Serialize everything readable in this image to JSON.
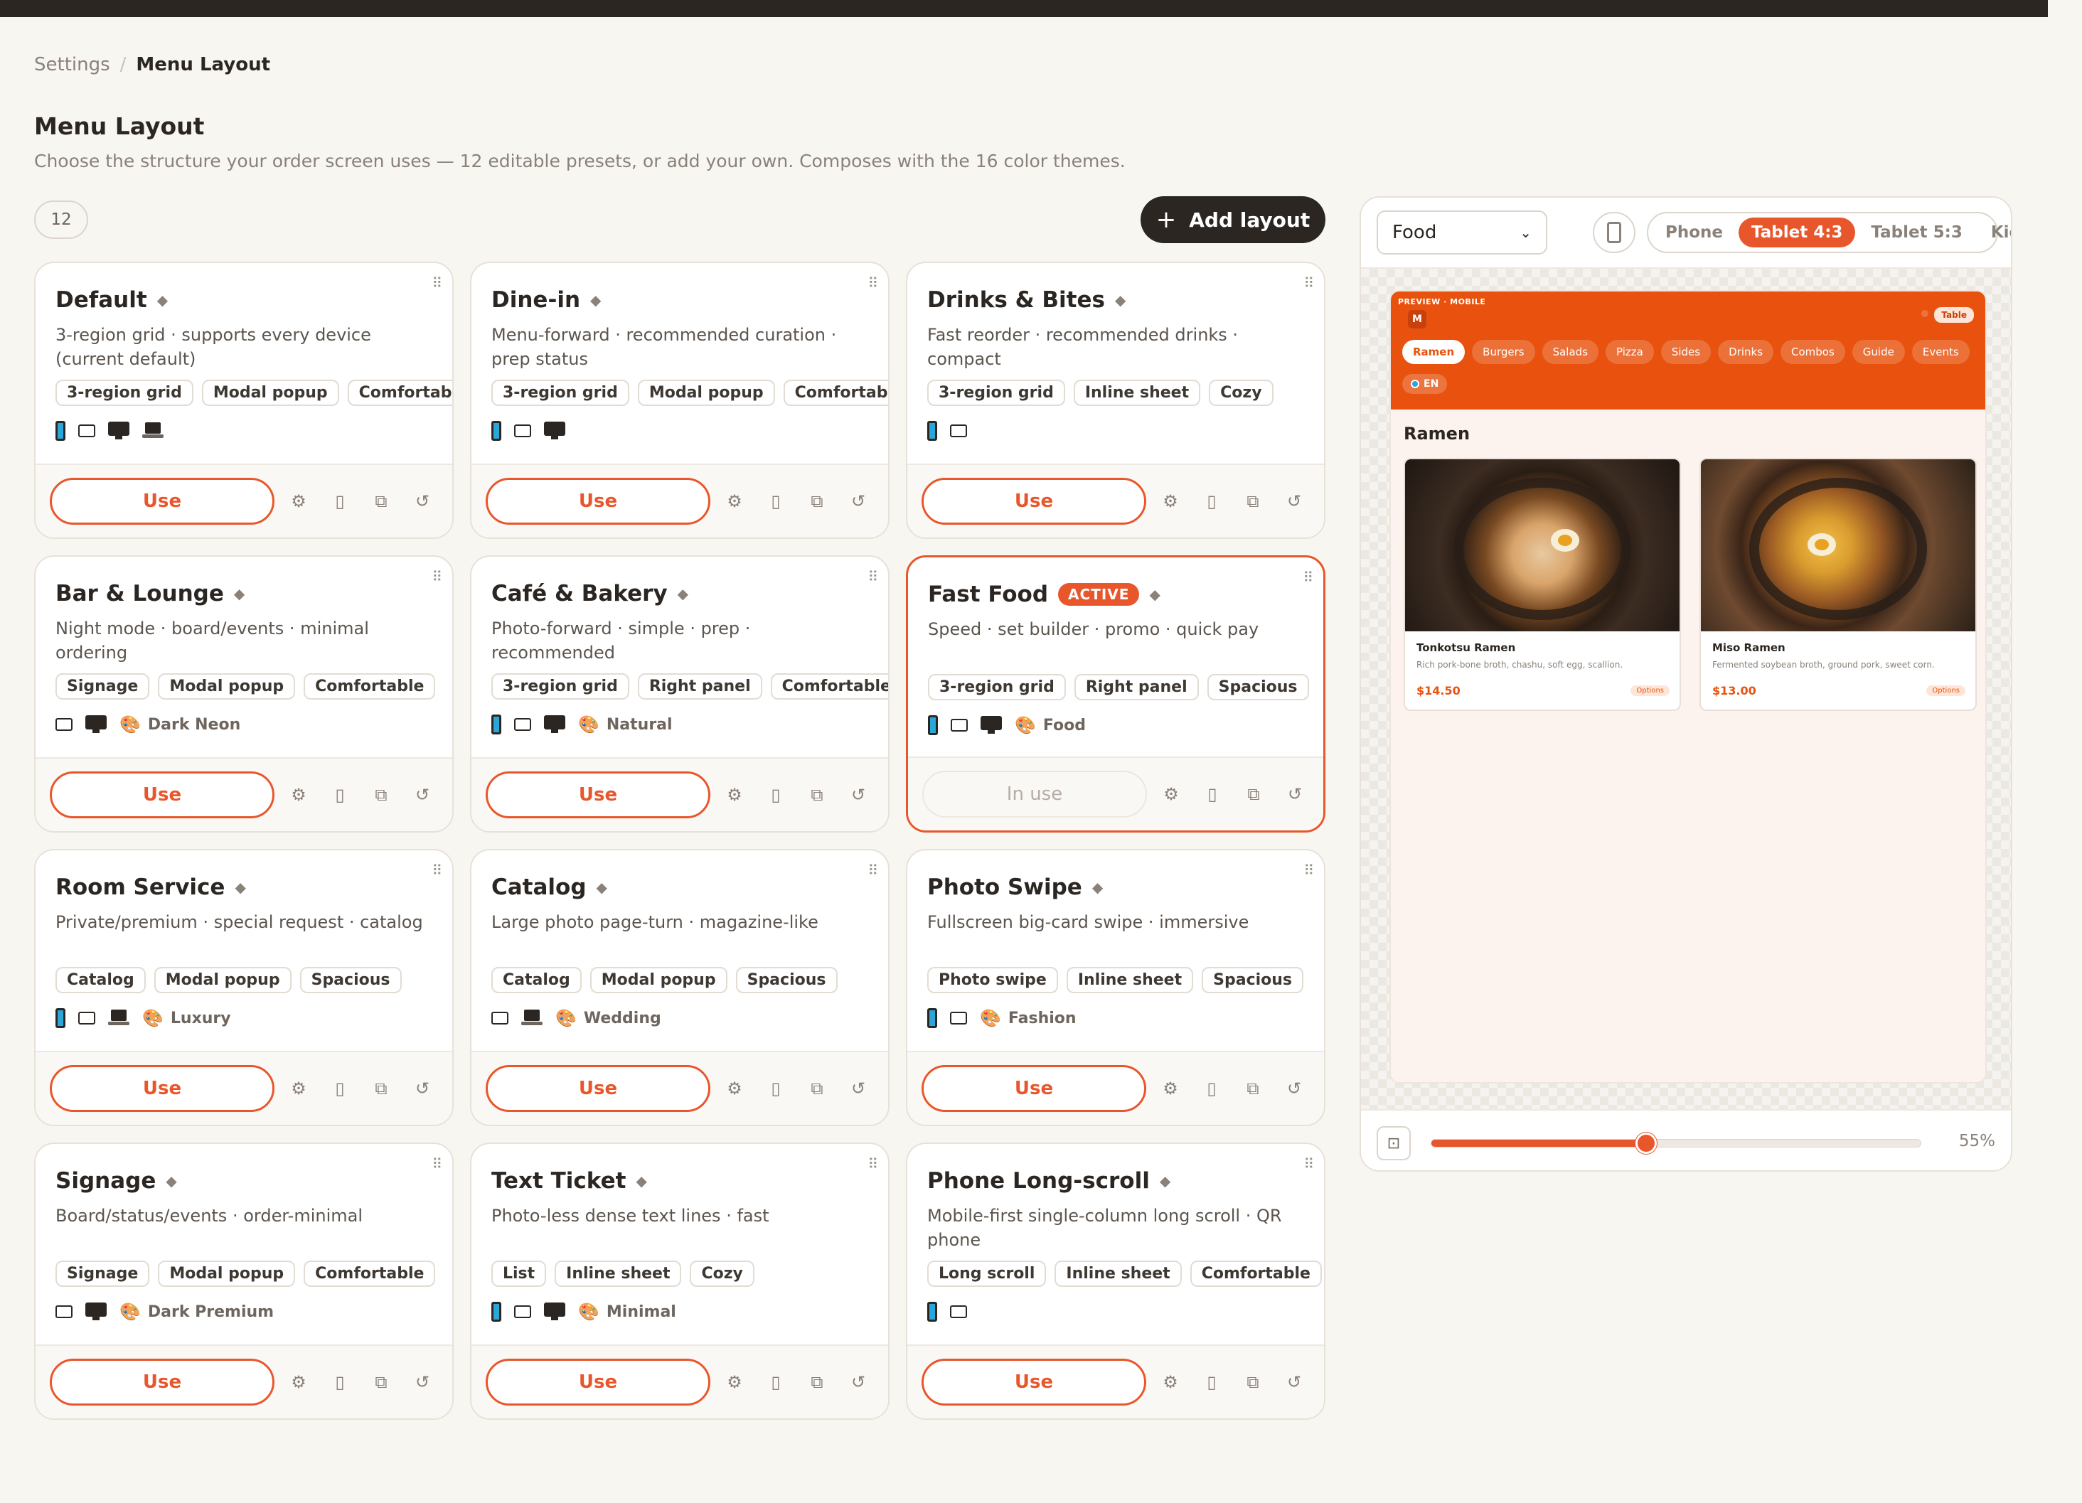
{
  "breadcrumb": {
    "parent": "Settings",
    "separator": "/",
    "current": "Menu Layout"
  },
  "page": {
    "title": "Menu Layout",
    "subtitle": "Choose the structure your order screen uses — 12 editable presets, or add your own. Composes with the 16 color themes.",
    "count": "12",
    "add_label": "Add layout",
    "add_icon": "+"
  },
  "cards": [
    {
      "title": "Default",
      "desc": "3-region grid · supports every device (current default)",
      "tags": [
        "3-region grid",
        "Modal popup",
        "Comfortable"
      ],
      "devices": [
        "phone",
        "tablet",
        "monitor",
        "laptop"
      ],
      "theme": "",
      "action": "Use",
      "active": false
    },
    {
      "title": "Dine-in",
      "desc": "Menu-forward · recommended curation · prep status",
      "tags": [
        "3-region grid",
        "Modal popup",
        "Comfortable"
      ],
      "devices": [
        "phone",
        "tablet",
        "monitor"
      ],
      "theme": "",
      "action": "Use",
      "active": false
    },
    {
      "title": "Drinks & Bites",
      "desc": "Fast reorder · recommended drinks · compact",
      "tags": [
        "3-region grid",
        "Inline sheet",
        "Cozy"
      ],
      "devices": [
        "phone",
        "tablet"
      ],
      "theme": "",
      "action": "Use",
      "active": false
    },
    {
      "title": "Bar & Lounge",
      "desc": "Night mode · board/events · minimal ordering",
      "tags": [
        "Signage",
        "Modal popup",
        "Comfortable"
      ],
      "devices": [
        "tablet",
        "monitor"
      ],
      "theme": "Dark Neon",
      "action": "Use",
      "active": false
    },
    {
      "title": "Café & Bakery",
      "desc": "Photo-forward · simple · prep · recommended",
      "tags": [
        "3-region grid",
        "Right panel",
        "Comfortable"
      ],
      "devices": [
        "phone",
        "tablet",
        "monitor"
      ],
      "theme": "Natural",
      "action": "Use",
      "active": false
    },
    {
      "title": "Fast Food",
      "badge": "ACTIVE",
      "desc": "Speed · set builder · promo · quick pay",
      "tags": [
        "3-region grid",
        "Right panel",
        "Spacious"
      ],
      "devices": [
        "phone",
        "tablet",
        "monitor"
      ],
      "theme": "Food",
      "action": "In use",
      "active": true
    },
    {
      "title": "Room Service",
      "desc": "Private/premium · special request · catalog",
      "tags": [
        "Catalog",
        "Modal popup",
        "Spacious"
      ],
      "devices": [
        "phone",
        "tablet",
        "laptop"
      ],
      "theme": "Luxury",
      "action": "Use",
      "active": false
    },
    {
      "title": "Catalog",
      "desc": "Large photo page-turn · magazine-like",
      "tags": [
        "Catalog",
        "Modal popup",
        "Spacious"
      ],
      "devices": [
        "tablet",
        "laptop"
      ],
      "theme": "Wedding",
      "action": "Use",
      "active": false
    },
    {
      "title": "Photo Swipe",
      "desc": "Fullscreen big-card swipe · immersive",
      "tags": [
        "Photo swipe",
        "Inline sheet",
        "Spacious"
      ],
      "devices": [
        "phone",
        "tablet"
      ],
      "theme": "Fashion",
      "action": "Use",
      "active": false
    },
    {
      "title": "Signage",
      "desc": "Board/status/events · order-minimal",
      "tags": [
        "Signage",
        "Modal popup",
        "Comfortable"
      ],
      "devices": [
        "tablet",
        "monitor"
      ],
      "theme": "Dark Premium",
      "action": "Use",
      "active": false
    },
    {
      "title": "Text Ticket",
      "desc": "Photo-less dense text lines · fast",
      "tags": [
        "List",
        "Inline sheet",
        "Cozy"
      ],
      "devices": [
        "phone",
        "tablet",
        "monitor"
      ],
      "theme": "Minimal",
      "action": "Use",
      "active": false
    },
    {
      "title": "Phone Long-scroll",
      "desc": "Mobile-first single-column long scroll · QR phone",
      "tags": [
        "Long scroll",
        "Inline sheet",
        "Comfortable"
      ],
      "devices": [
        "phone",
        "tablet"
      ],
      "theme": "",
      "action": "Use",
      "active": false
    }
  ],
  "card_icons": {
    "drag": "⠿",
    "diamond": "◆",
    "settings": "⚙",
    "phone": "▯",
    "duplicate": "⧉",
    "reset": "↺",
    "palette": "🎨"
  },
  "preview": {
    "theme_select": "Food",
    "devices": [
      "Phone",
      "Tablet 4:3",
      "Tablet 5:3",
      "Kiosk"
    ],
    "device_selected": "Tablet 4:3",
    "label": "PREVIEW · MOBILE",
    "logo": "M",
    "table_chip": "Table",
    "categories": [
      "Ramen",
      "Burgers",
      "Salads",
      "Pizza",
      "Sides",
      "Drinks",
      "Combos",
      "Guide",
      "Events"
    ],
    "category_selected": "Ramen",
    "language": "EN",
    "section_title": "Ramen",
    "items": [
      {
        "name": "Tonkotsu Ramen",
        "desc": "Rich pork-bone broth, chashu, soft egg, scallion.",
        "price": "$14.50",
        "options": "Options"
      },
      {
        "name": "Miso Ramen",
        "desc": "Fermented soybean broth, ground pork, sweet corn.",
        "price": "$13.00",
        "options": "Options"
      }
    ],
    "zoom": {
      "value": 0.55,
      "label": "55%"
    }
  },
  "colors": {
    "accent": "#e8572c",
    "header": "#e8520e",
    "dark": "#2b2622"
  }
}
